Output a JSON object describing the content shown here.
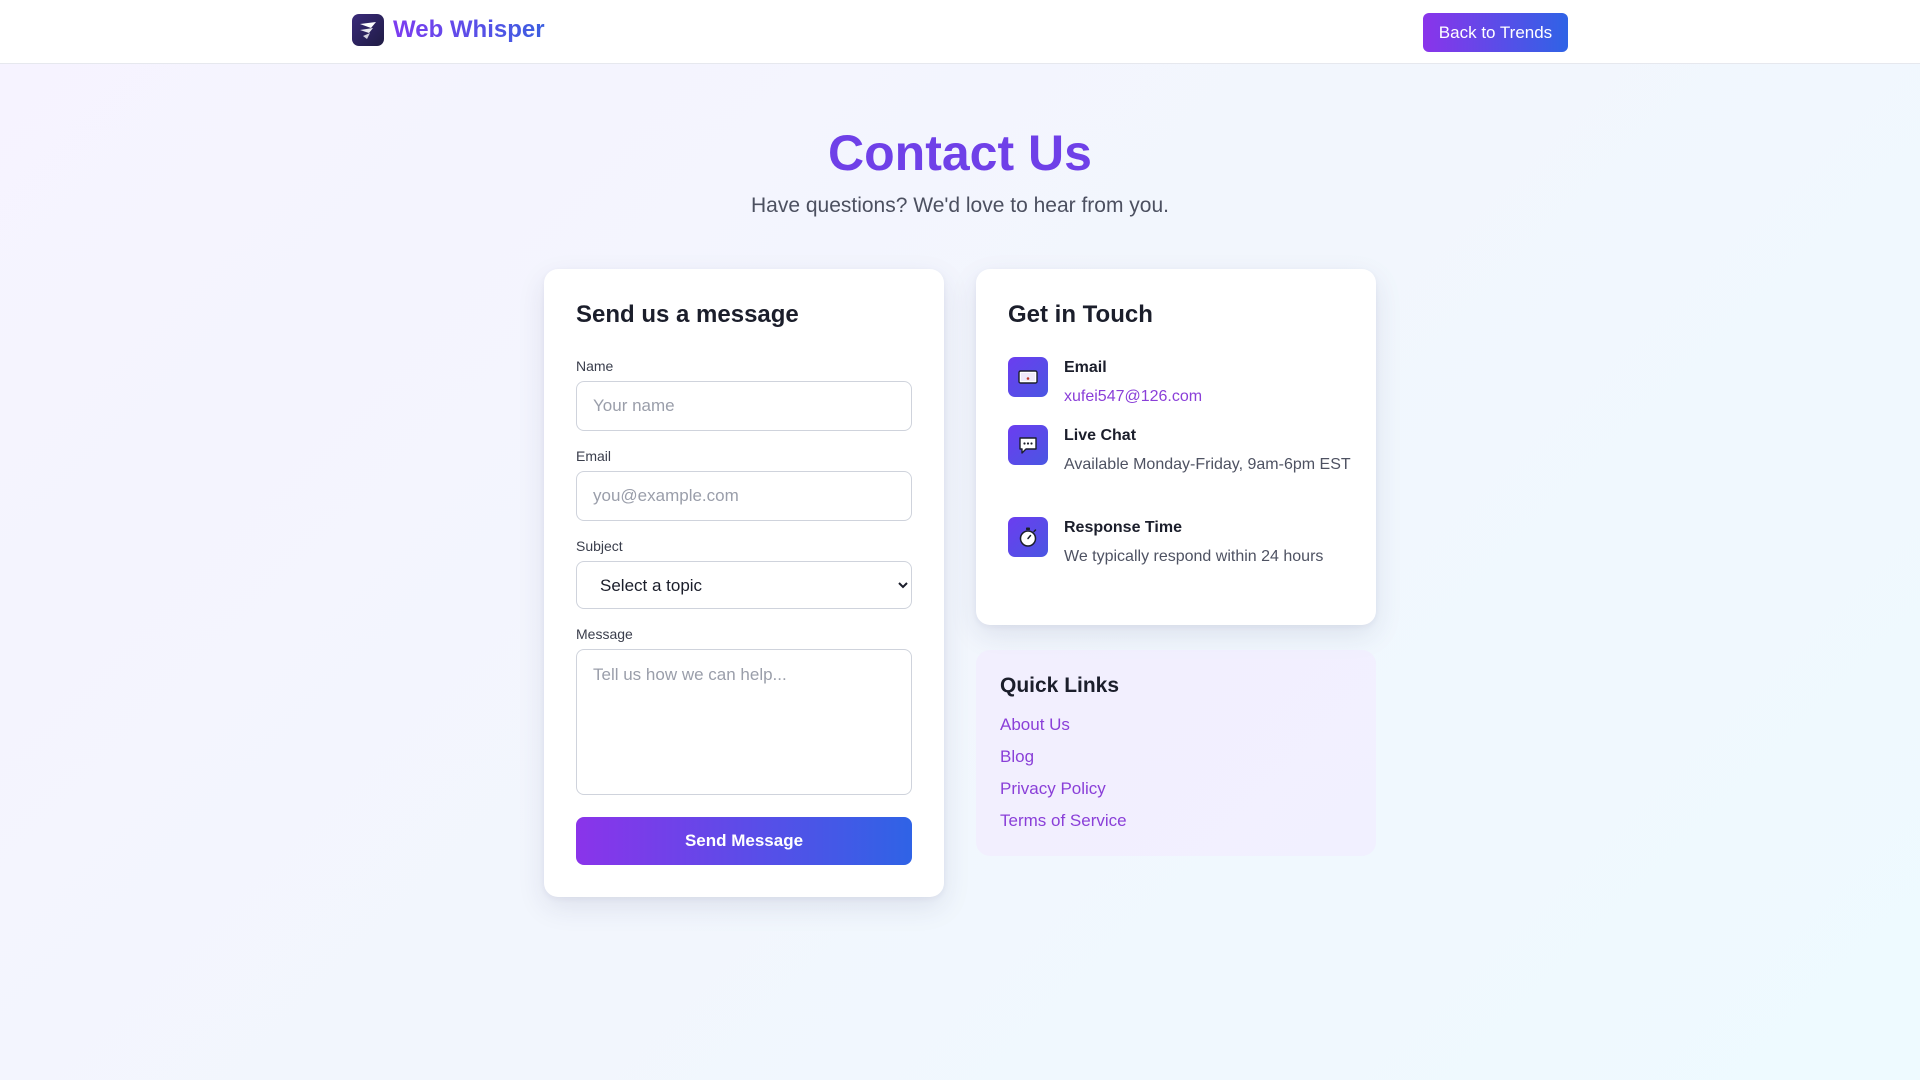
{
  "header": {
    "brand_name": "Web Whisper",
    "back_button_label": "Back to Trends"
  },
  "hero": {
    "title": "Contact Us",
    "subtitle": "Have questions? We'd love to hear from you."
  },
  "form": {
    "title": "Send us a message",
    "name_label": "Name",
    "name_placeholder": "Your name",
    "email_label": "Email",
    "email_placeholder": "you@example.com",
    "subject_label": "Subject",
    "subject_selected": "Select a topic",
    "message_label": "Message",
    "message_placeholder": "Tell us how we can help...",
    "submit_label": "Send Message"
  },
  "touch": {
    "title": "Get in Touch",
    "items": [
      {
        "icon": "envelope-icon",
        "title": "Email",
        "text": "xufei547@126.com"
      },
      {
        "icon": "chat-bubble-icon",
        "title": "Live Chat",
        "text": "Available Monday-Friday, 9am-6pm EST"
      },
      {
        "icon": "stopwatch-icon",
        "title": "Response Time",
        "text": "We typically respond within 24 hours"
      }
    ]
  },
  "quick_links": {
    "title": "Quick Links",
    "links": [
      "About Us",
      "Blog",
      "Privacy Policy",
      "Terms of Service"
    ]
  },
  "colors": {
    "accent_purple": "#8a34ea",
    "accent_blue": "#2f63e6",
    "title_purple": "#6f40e8",
    "link_purple": "#8a3fd8"
  }
}
